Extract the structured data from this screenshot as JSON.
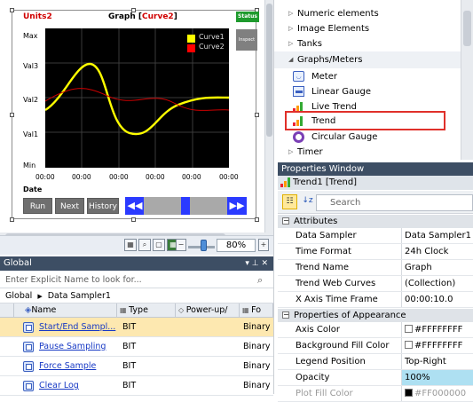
{
  "trend": {
    "units": "Units2",
    "graph_prefix": "Graph [",
    "graph_curve": "Curve2",
    "graph_suffix": "]",
    "status": "Status",
    "inspect": "Inspect",
    "y_labels": [
      "Max",
      "Val3",
      "Val2",
      "Val1",
      "Min"
    ],
    "x_labels": [
      "00:00",
      "00:00",
      "00:00",
      "00:00",
      "00:00",
      "00:00"
    ],
    "date_label": "Date",
    "legend": [
      {
        "name": "Curve1",
        "color": "#ffff00"
      },
      {
        "name": "Curve2",
        "color": "#ff0000"
      }
    ],
    "buttons": {
      "run": "Run",
      "next": "Next",
      "history": "History"
    }
  },
  "designer": {
    "zoom": "80%"
  },
  "toolbox": {
    "categories": [
      "Numeric elements",
      "Image Elements",
      "Tanks",
      "Graphs/Meters"
    ],
    "items": [
      "Meter",
      "Linear Gauge",
      "Live Trend",
      "Trend",
      "Circular Gauge"
    ],
    "timer": "Timer"
  },
  "global": {
    "title": "Global",
    "header_icons": "▾ ⊥ ✕",
    "search_placeholder": "Enter Explicit Name to look for...",
    "breadcrumb": [
      "Global",
      "Data Sampler1"
    ],
    "columns": [
      "Name",
      "Type",
      "Power-up/",
      "Fo"
    ],
    "rows": [
      {
        "name": "Start/End Sampl...",
        "type": "BIT",
        "format": "Binary"
      },
      {
        "name": "Pause Sampling",
        "type": "BIT",
        "format": "Binary"
      },
      {
        "name": "Force Sample",
        "type": "BIT",
        "format": "Binary"
      },
      {
        "name": "Clear Log",
        "type": "BIT",
        "format": "Binary"
      }
    ]
  },
  "properties": {
    "title": "Properties Window",
    "object": "Trend1 [Trend]",
    "search_placeholder": "Search",
    "cat_attributes": "Attributes",
    "attributes": [
      {
        "k": "Data Sampler",
        "v": "Data Sampler1"
      },
      {
        "k": "Time Format",
        "v": "24h Clock"
      },
      {
        "k": "Trend Name",
        "v": "Graph"
      },
      {
        "k": "Trend Web Curves",
        "v": "(Collection)"
      },
      {
        "k": "X Axis Time Frame",
        "v": "00:00:10.0"
      }
    ],
    "cat_appearance": "Properties of Appearance",
    "appearance": [
      {
        "k": "Axis Color",
        "v": "#FFFFFFFF"
      },
      {
        "k": "Background Fill Color",
        "v": "#FFFFFFFF"
      },
      {
        "k": "Legend Position",
        "v": "Top-Right"
      },
      {
        "k": "Opacity",
        "v": "100%"
      },
      {
        "k": "Plot Fill Color",
        "v": "#FF000000"
      }
    ]
  }
}
